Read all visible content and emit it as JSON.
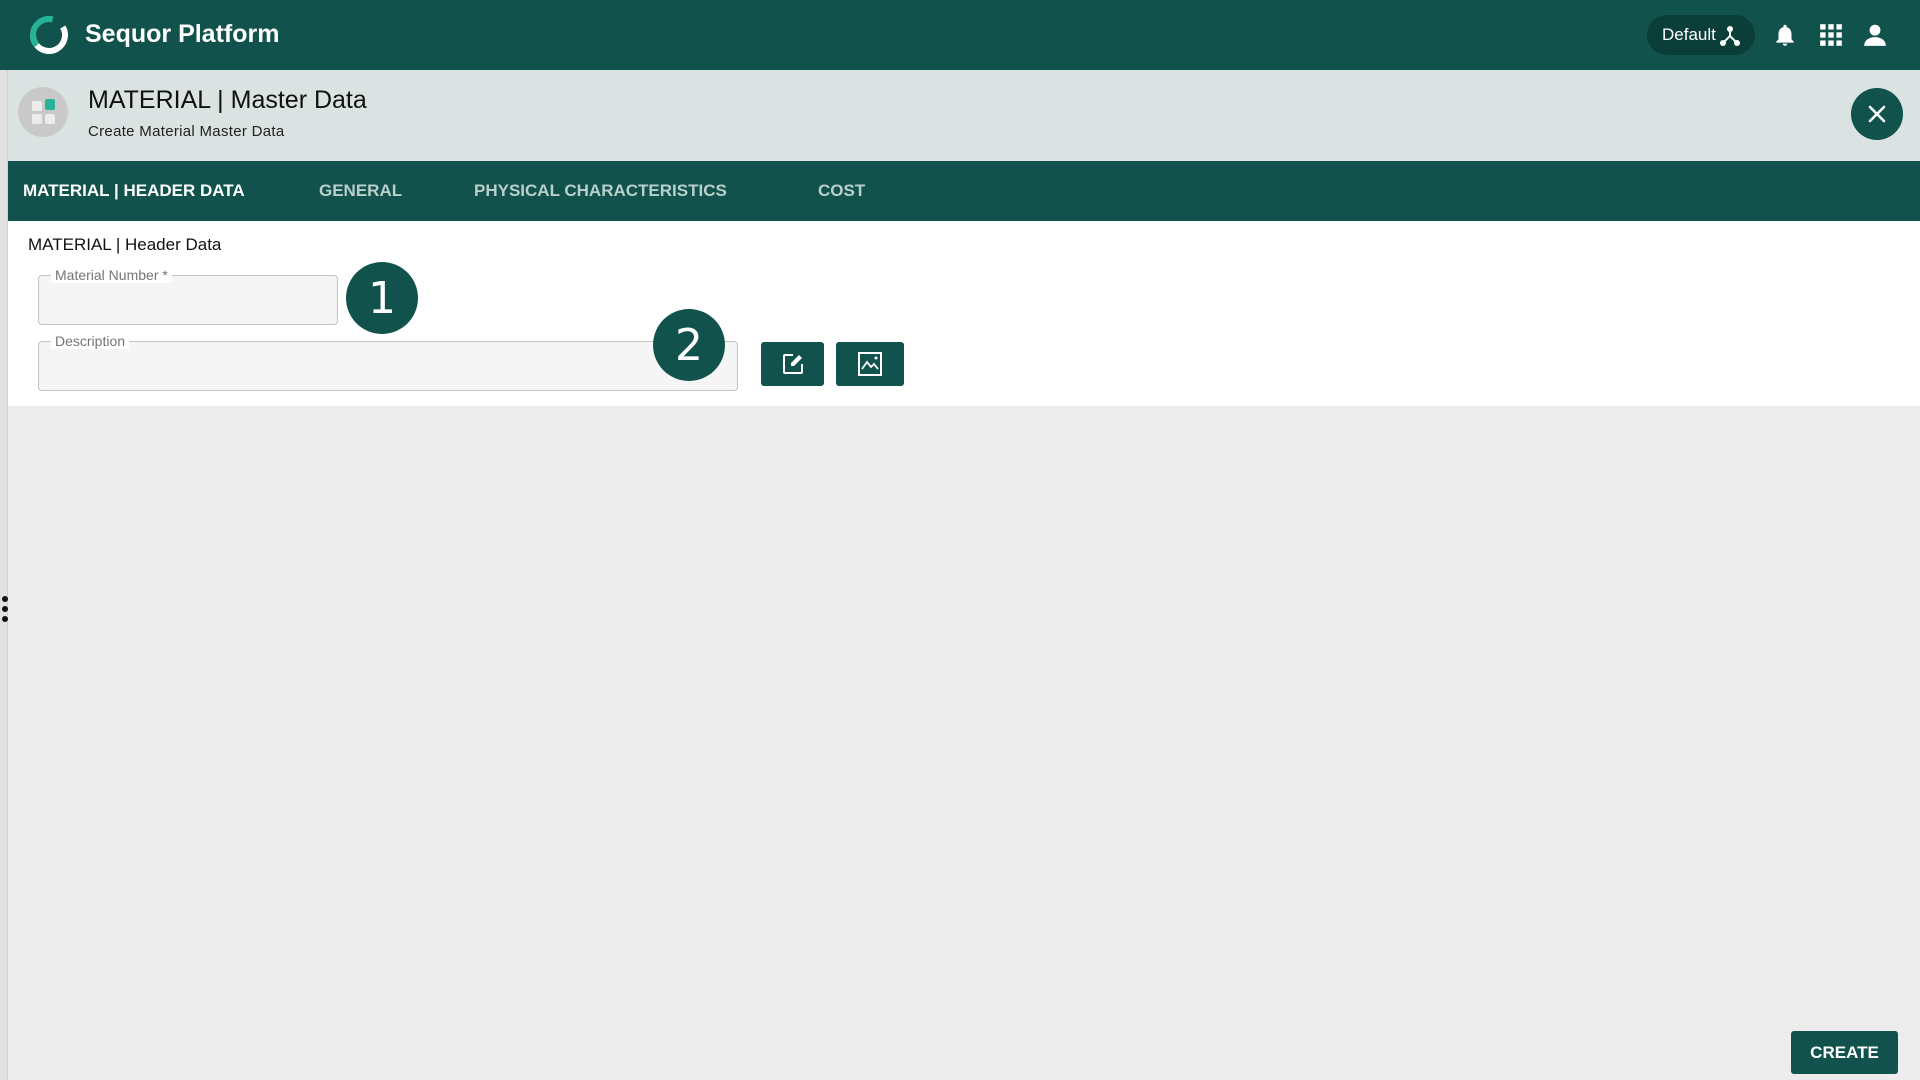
{
  "topbar": {
    "app_title": "Sequor Platform",
    "org_selector": "Default",
    "icons": [
      "sequor-logo-icon",
      "network-icon",
      "bell-icon",
      "apps-grid-icon",
      "user-icon"
    ]
  },
  "page_header": {
    "title": "MATERIAL | Master Data",
    "subtitle": "Create Material Master Data"
  },
  "tabs": [
    {
      "label": "MATERIAL | HEADER DATA",
      "active": true
    },
    {
      "label": "GENERAL",
      "active": false
    },
    {
      "label": "PHYSICAL CHARACTERISTICS",
      "active": false
    },
    {
      "label": "COST",
      "active": false
    }
  ],
  "form": {
    "section_title": "MATERIAL | Header Data",
    "material_number": {
      "label": "Material Number *",
      "value": ""
    },
    "description": {
      "label": "Description",
      "value": ""
    },
    "annotations": [
      "1",
      "2"
    ]
  },
  "actions": {
    "create_label": "CREATE"
  },
  "colors": {
    "brand": "#11524c",
    "accent": "#27b397",
    "background": "#ececec",
    "header_bg": "#dbe2e2"
  }
}
